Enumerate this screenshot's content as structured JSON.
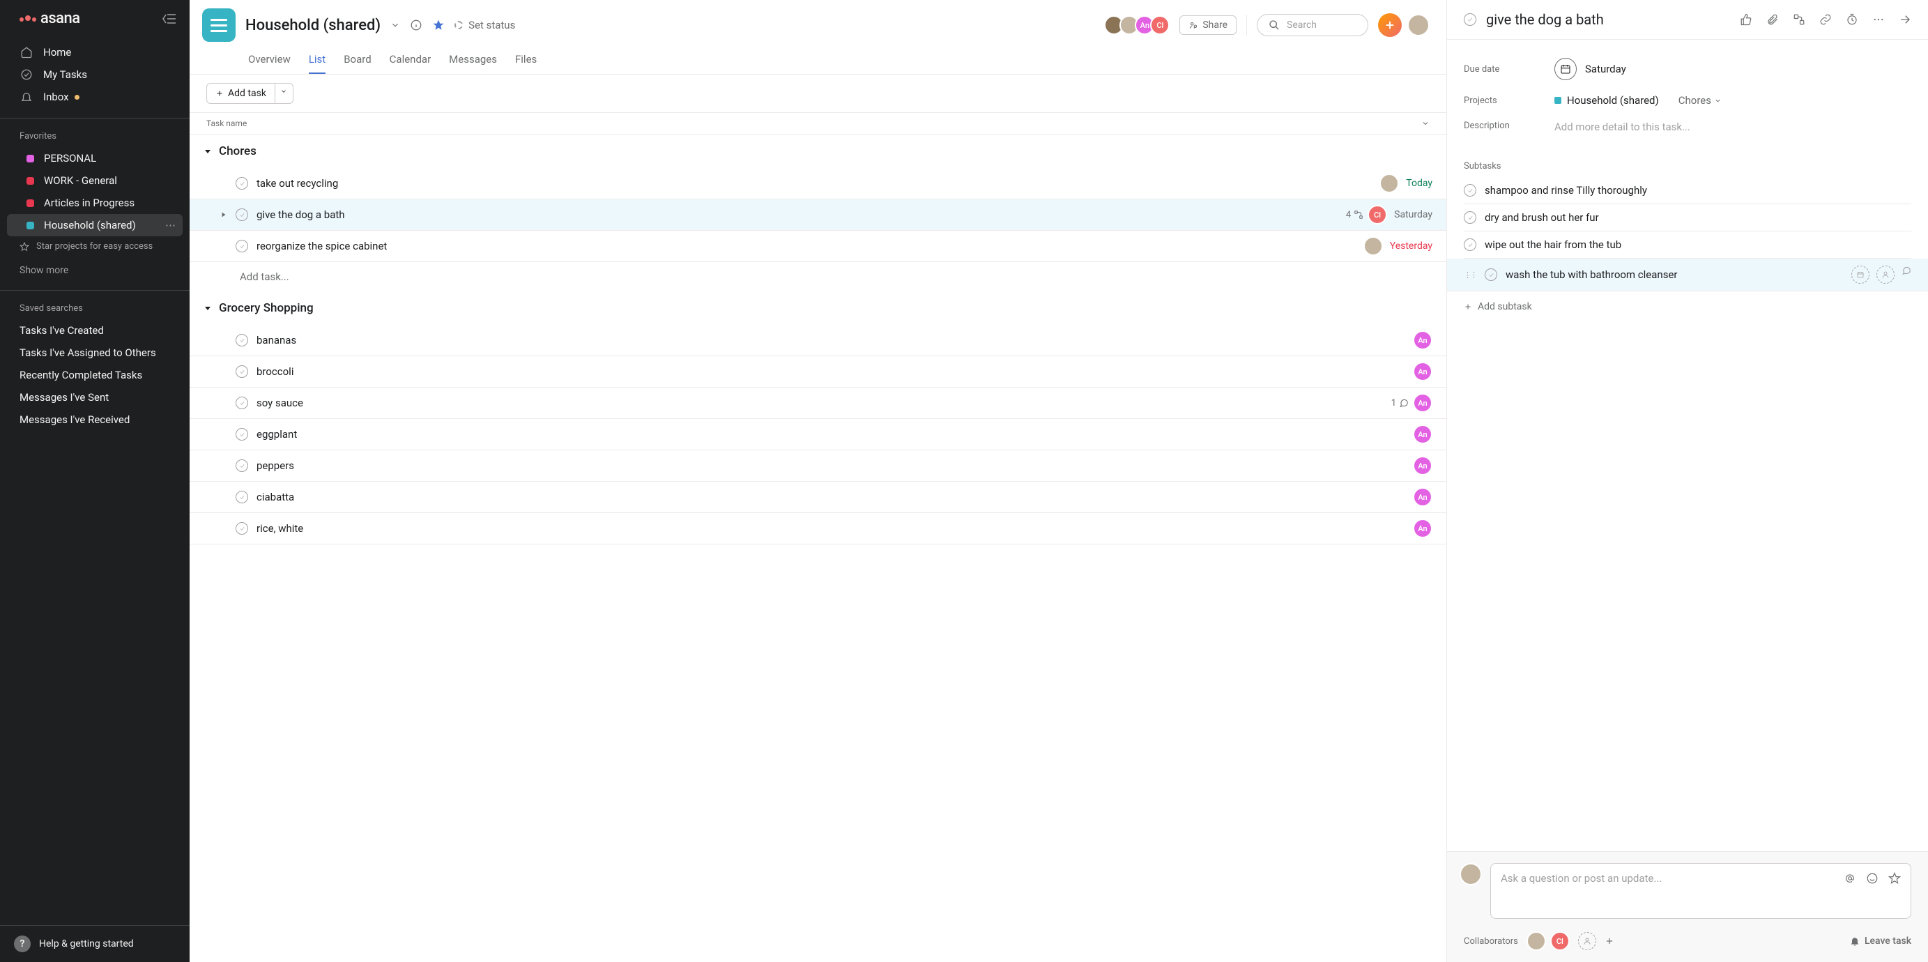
{
  "sidebar": {
    "logo": "asana",
    "nav": [
      {
        "label": "Home"
      },
      {
        "label": "My Tasks"
      },
      {
        "label": "Inbox",
        "badge": true
      }
    ],
    "favorites_heading": "Favorites",
    "favorites": [
      {
        "label": "PERSONAL",
        "color": "#e362e3"
      },
      {
        "label": "WORK - General",
        "color": "#e8384f"
      },
      {
        "label": "Articles in Progress",
        "color": "#e8384f"
      },
      {
        "label": "Household (shared)",
        "color": "#37b4c3",
        "active": true
      }
    ],
    "star_hint": "Star projects for easy access",
    "show_more": "Show more",
    "saved_heading": "Saved searches",
    "saved": [
      "Tasks I've Created",
      "Tasks I've Assigned to Others",
      "Recently Completed Tasks",
      "Messages I've Sent",
      "Messages I've Received"
    ],
    "help": "Help & getting started"
  },
  "header": {
    "title": "Household (shared)",
    "set_status": "Set status",
    "share": "Share",
    "search_placeholder": "Search",
    "tabs": [
      "Overview",
      "List",
      "Board",
      "Calendar",
      "Messages",
      "Files"
    ],
    "active_tab": "List",
    "avatars": [
      {
        "kind": "photo",
        "class": "av-dog"
      },
      {
        "kind": "photo",
        "class": "av-photo"
      },
      {
        "kind": "initials",
        "text": "An",
        "class": "av-pink"
      },
      {
        "kind": "initials",
        "text": "Cl",
        "class": "av-coral"
      }
    ]
  },
  "toolbar": {
    "add_task": "Add task"
  },
  "columns": {
    "task_name": "Task name"
  },
  "sections": [
    {
      "name": "Chores",
      "tasks": [
        {
          "name": "take out recycling",
          "assignee": {
            "kind": "photo",
            "class": "av-photo"
          },
          "due": "Today",
          "due_class": "due-today"
        },
        {
          "name": "give the dog a bath",
          "assignee": {
            "kind": "initials",
            "text": "Cl",
            "class": "av-coral"
          },
          "due": "Saturday",
          "due_class": "due-future",
          "subtasks": 4,
          "selected": true,
          "expandable": true
        },
        {
          "name": "reorganize the spice cabinet",
          "assignee": {
            "kind": "photo",
            "class": "av-photo"
          },
          "due": "Yesterday",
          "due_class": "due-past"
        }
      ],
      "add_placeholder": "Add task..."
    },
    {
      "name": "Grocery Shopping",
      "tasks": [
        {
          "name": "bananas",
          "assignee": {
            "kind": "initials",
            "text": "An",
            "class": "av-pink"
          }
        },
        {
          "name": "broccoli",
          "assignee": {
            "kind": "initials",
            "text": "An",
            "class": "av-pink"
          }
        },
        {
          "name": "soy sauce",
          "assignee": {
            "kind": "initials",
            "text": "An",
            "class": "av-pink"
          },
          "comments": 1
        },
        {
          "name": "eggplant",
          "assignee": {
            "kind": "initials",
            "text": "An",
            "class": "av-pink"
          }
        },
        {
          "name": "peppers",
          "assignee": {
            "kind": "initials",
            "text": "An",
            "class": "av-pink"
          }
        },
        {
          "name": "ciabatta",
          "assignee": {
            "kind": "initials",
            "text": "An",
            "class": "av-pink"
          }
        },
        {
          "name": "rice, white",
          "assignee": {
            "kind": "initials",
            "text": "An",
            "class": "av-pink"
          }
        }
      ]
    }
  ],
  "detail": {
    "title": "give the dog a bath",
    "fields": {
      "due_label": "Due date",
      "due_value": "Saturday",
      "projects_label": "Projects",
      "project_name": "Household (shared)",
      "project_section": "Chores",
      "description_label": "Description",
      "description_placeholder": "Add more detail to this task..."
    },
    "subtasks_label": "Subtasks",
    "subtasks": [
      {
        "name": "shampoo and rinse Tilly thoroughly"
      },
      {
        "name": "dry and brush out her fur"
      },
      {
        "name": "wipe out the hair from the tub"
      },
      {
        "name": "wash the tub with bathroom cleanser",
        "hover": true
      }
    ],
    "add_subtask": "Add subtask",
    "comment_placeholder": "Ask a question or post an update...",
    "collaborators_label": "Collaborators",
    "leave": "Leave task"
  }
}
